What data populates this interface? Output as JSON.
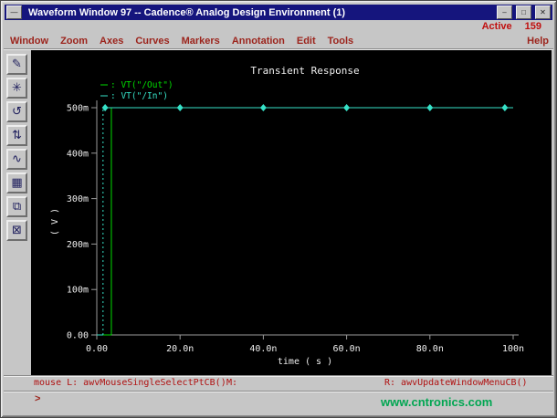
{
  "window": {
    "title": "Waveform Window 97 -- Cadence® Analog Design Environment (1)",
    "controls": {
      "menu_glyph": "—",
      "minimize_glyph": "–",
      "maximize_glyph": "□",
      "close_glyph": "✕"
    }
  },
  "status_top": {
    "label": "Active",
    "value": "159"
  },
  "menu_bar": {
    "items": [
      "Window",
      "Zoom",
      "Axes",
      "Curves",
      "Markers",
      "Annotation",
      "Edit",
      "Tools"
    ],
    "help": "Help"
  },
  "toolbar": {
    "buttons": [
      {
        "name": "tool-probe-button",
        "icon": "pen-icon",
        "glyph": "✎"
      },
      {
        "name": "tool-zoom-fit-button",
        "icon": "asterisk-icon",
        "glyph": "✳"
      },
      {
        "name": "tool-redraw-button",
        "icon": "loop-arrow-icon",
        "glyph": "↺"
      },
      {
        "name": "tool-strip-chart-button",
        "icon": "arrows-up-down-icon",
        "glyph": "⇅"
      },
      {
        "name": "tool-subwindow-button",
        "icon": "waveform-icon",
        "glyph": "∿"
      },
      {
        "name": "tool-calculator-button",
        "icon": "calculator-icon",
        "glyph": "▦"
      },
      {
        "name": "tool-copy-window-button",
        "icon": "copy-icon",
        "glyph": "⧉"
      },
      {
        "name": "tool-delete-button",
        "icon": "box-x-icon",
        "glyph": "⊠"
      }
    ]
  },
  "chart_data": {
    "type": "line",
    "title": "Transient Response",
    "xlabel": "time ( s )",
    "ylabel": "( V )",
    "background": "#000000",
    "x_unit": "ns",
    "x_range": [
      0,
      100
    ],
    "y_range": [
      0,
      0.5
    ],
    "grid": false,
    "legend_position": "top-left",
    "x_ticks": [
      {
        "t": 0,
        "label": "0.00"
      },
      {
        "t": 20,
        "label": "20.0n"
      },
      {
        "t": 40,
        "label": "40.0n"
      },
      {
        "t": 60,
        "label": "60.0n"
      },
      {
        "t": 80,
        "label": "80.0n"
      },
      {
        "t": 100,
        "label": "100n"
      }
    ],
    "y_ticks": [
      {
        "v": 0.0,
        "label": "0.00"
      },
      {
        "v": 0.1,
        "label": "100m"
      },
      {
        "v": 0.2,
        "label": "200m"
      },
      {
        "v": 0.3,
        "label": "300m"
      },
      {
        "v": 0.4,
        "label": "400m"
      },
      {
        "v": 0.5,
        "label": "500m"
      }
    ],
    "series": [
      {
        "name": "VT(\"/Out\")",
        "legend_label": ": VT(\"/Out\")",
        "color": "#00dd00",
        "segments": [
          {
            "pts": [
              [
                0,
                0
              ],
              [
                3.5,
                0
              ]
            ]
          },
          {
            "pts": [
              [
                3.5,
                0
              ],
              [
                3.5,
                0.5
              ]
            ]
          },
          {
            "pts": [
              [
                3.5,
                0.5
              ],
              [
                100,
                0.5
              ]
            ]
          }
        ]
      },
      {
        "name": "VT(\"/In\")",
        "legend_label": ": VT(\"/In\")",
        "color": "#36e2c8",
        "segments": [
          {
            "pts": [
              [
                0,
                0
              ],
              [
                1.5,
                0
              ]
            ]
          },
          {
            "pts": [
              [
                1.5,
                0
              ],
              [
                1.5,
                0.5
              ]
            ],
            "dash": "2,3"
          },
          {
            "pts": [
              [
                1.5,
                0.5
              ],
              [
                100,
                0.5
              ]
            ]
          }
        ],
        "markers": {
          "shape": "diamond",
          "times": [
            2,
            20,
            40,
            60,
            80,
            98
          ],
          "value": 0.5
        }
      }
    ]
  },
  "status_bar": {
    "left": "mouse L: awvMouseSingleSelectPtCB()",
    "middle": "M:",
    "right": "R: awvUpdateWindowMenuCB()"
  },
  "prompt": ">",
  "watermark": "www.cntronics.com",
  "colors": {
    "titlebar": "#15157d",
    "menu_text": "#9c241c",
    "active_text": "#c01010",
    "status_text": "#b01010",
    "watermark": "#00a651",
    "plot_axis": "#9a9a9a",
    "plot_text": "#f0f0f0"
  }
}
